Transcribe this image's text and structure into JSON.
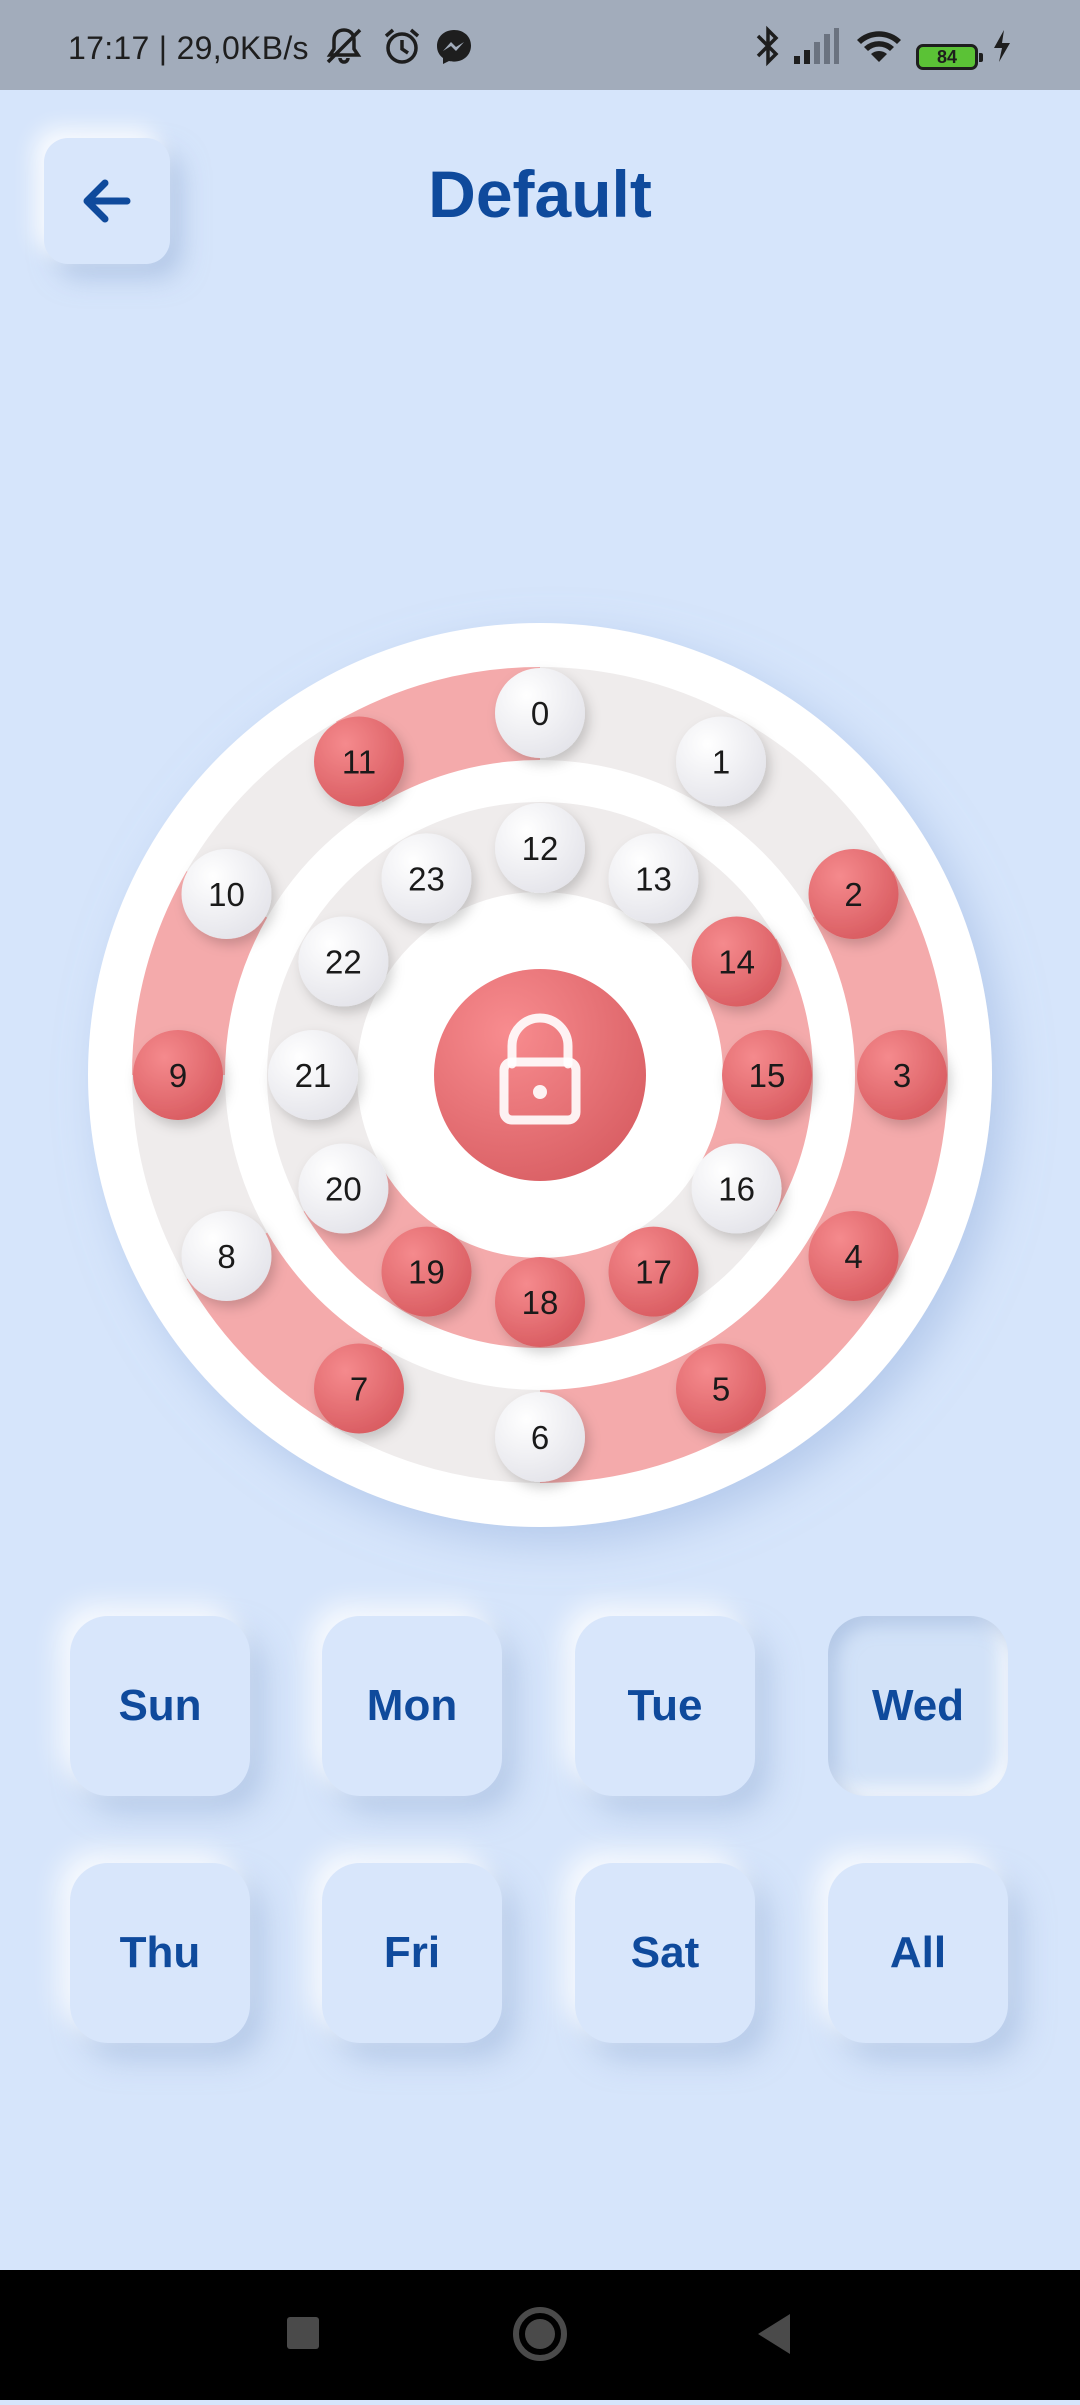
{
  "status_bar": {
    "text": "17:17 | 29,0KB/s",
    "battery": "84",
    "icons": [
      "mute-icon",
      "alarm-icon",
      "messenger-icon",
      "bluetooth-icon",
      "signal-icon",
      "wifi-icon",
      "battery-icon",
      "charging-icon"
    ]
  },
  "header": {
    "title": "Default",
    "back_icon": "arrow-left-icon"
  },
  "dial": {
    "outer_hours": [
      "0",
      "1",
      "2",
      "3",
      "4",
      "5",
      "6",
      "7",
      "8",
      "9",
      "10",
      "11"
    ],
    "inner_hours": [
      "12",
      "13",
      "14",
      "15",
      "16",
      "17",
      "18",
      "19",
      "20",
      "21",
      "22",
      "23"
    ],
    "active_hours": [
      2,
      3,
      4,
      5,
      7,
      9,
      11,
      14,
      15,
      17,
      18,
      19
    ],
    "center_icon": "lock-icon",
    "colors": {
      "active": "#e96e72",
      "inactive": "#f4f4f6",
      "band_active": "#f4aaab",
      "band_inactive": "#efecec",
      "text": "#1a1a1a"
    }
  },
  "days": {
    "row1": [
      "Sun",
      "Mon",
      "Tue",
      "Wed"
    ],
    "row2": [
      "Thu",
      "Fri",
      "Sat",
      "All"
    ],
    "selected": "Wed"
  },
  "nav": {
    "icons": [
      "recents-square-icon",
      "home-circle-icon",
      "back-triangle-icon"
    ]
  }
}
